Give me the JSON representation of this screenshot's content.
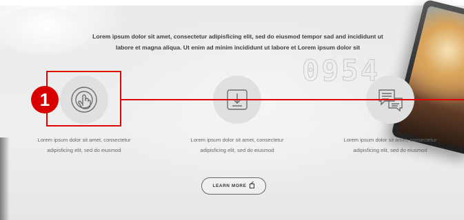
{
  "intro": {
    "line1": "Lorem ipsum dolor sit amet, consectetur adipisficing elit, sed do eiusmod tempor sad and incididunt ut",
    "line2": "labore et magna aliqua. Ut enim ad minim incididunt ut labore et Lorem ipsum dolor sit"
  },
  "decor_numbers": "0954",
  "features": [
    {
      "icon": "touch-icon",
      "line1": "Lorem ipsum dolor sit amet, consectetur",
      "line2": "adipisficing elit, sed do eiusmod"
    },
    {
      "icon": "download-icon",
      "line1": "Lorem ipsum dolor sit amet, consectetur",
      "line2": "adipisficing elit, sed do eiusmod"
    },
    {
      "icon": "chat-icon",
      "line1": "Lorem ipsum dolor sit amet, consectetur",
      "line2": "adipisficing elit, sed do eiusmod"
    }
  ],
  "cta": {
    "label": "LEARN MORE"
  },
  "annotation": {
    "marker": "1",
    "color": "#e00000"
  }
}
